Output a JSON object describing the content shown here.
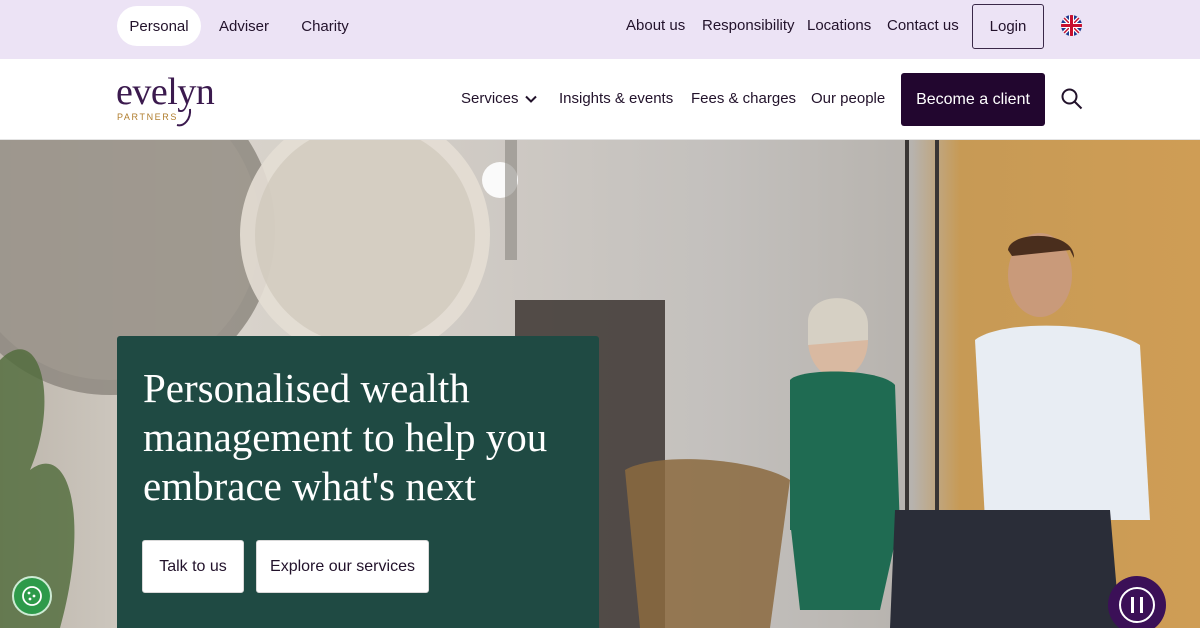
{
  "topbar": {
    "segments": [
      "Personal",
      "Adviser",
      "Charity"
    ],
    "links": [
      "About us",
      "Responsibility",
      "Locations",
      "Contact us"
    ],
    "login_label": "Login"
  },
  "logo": {
    "word": "evelyn",
    "sub": "PARTNERS"
  },
  "nav": {
    "items": [
      "Services",
      "Insights & events",
      "Fees & charges",
      "Our people"
    ],
    "cta_label": "Become a client"
  },
  "hero": {
    "headline": "Personalised wealth management to help you embrace what's next",
    "buttons": [
      "Talk to us",
      "Explore our services"
    ]
  },
  "colors": {
    "topbar_bg": "#ece3f5",
    "brand_purple": "#22062f",
    "panel_green": "#1f4a43",
    "logo_gold": "#b07d2d"
  },
  "icons": [
    "uk-flag-icon",
    "chevron-down-icon",
    "search-icon",
    "cookie-icon",
    "pause-icon"
  ]
}
